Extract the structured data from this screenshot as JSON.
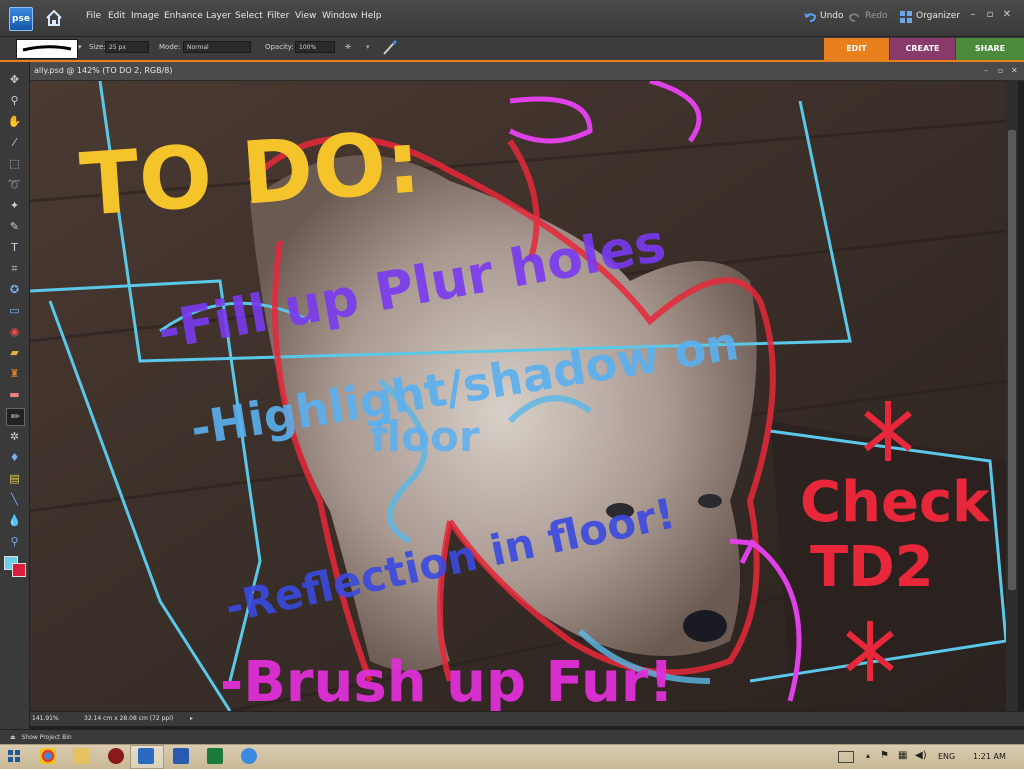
{
  "app": {
    "logo_text": "pse",
    "menu": [
      "File",
      "Edit",
      "Image",
      "Enhance",
      "Layer",
      "Select",
      "Filter",
      "View",
      "Window",
      "Help"
    ],
    "undo_label": "Undo",
    "redo_label": "Redo",
    "organizer_label": "Organizer"
  },
  "options": {
    "size_label": "Size:",
    "size_value": "25 px",
    "mode_label": "Mode:",
    "mode_value": "Normal",
    "opacity_label": "Opacity:",
    "opacity_value": "100%"
  },
  "tabs": [
    {
      "label": "EDIT",
      "color": "#e8801e"
    },
    {
      "label": "CREATE",
      "color": "#a33a7a"
    },
    {
      "label": "SHARE",
      "color": "#5a9a3a"
    }
  ],
  "document": {
    "title": "ally.psd @ 142% (TO DO 2, RGB/8)",
    "zoom": "141.91%",
    "dimensions": "32.14 cm x 28.08 cm (72 ppi)"
  },
  "canvas_text": {
    "todo": "TO DO:",
    "line1": "-Fill up Plur holes",
    "line2": "-Highlight/shadow on",
    "line3": "floor",
    "line4": "-Reflection in floor!",
    "line5": "-Brush up Fur!",
    "check1": "Check",
    "check2": "TD2"
  },
  "project_bin_label": "Show Project Bin",
  "taskbar": {
    "language": "ENG",
    "time": "1:21 AM"
  }
}
